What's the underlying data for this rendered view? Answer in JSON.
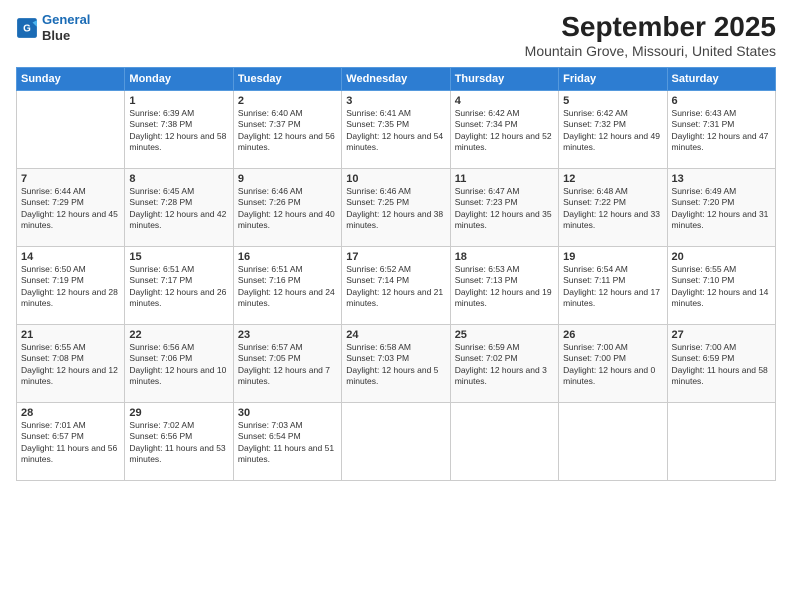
{
  "logo": {
    "line1": "General",
    "line2": "Blue"
  },
  "title": "September 2025",
  "location": "Mountain Grove, Missouri, United States",
  "days_header": [
    "Sunday",
    "Monday",
    "Tuesday",
    "Wednesday",
    "Thursday",
    "Friday",
    "Saturday"
  ],
  "weeks": [
    [
      {
        "day": "",
        "sunrise": "",
        "sunset": "",
        "daylight": ""
      },
      {
        "day": "1",
        "sunrise": "Sunrise: 6:39 AM",
        "sunset": "Sunset: 7:38 PM",
        "daylight": "Daylight: 12 hours and 58 minutes."
      },
      {
        "day": "2",
        "sunrise": "Sunrise: 6:40 AM",
        "sunset": "Sunset: 7:37 PM",
        "daylight": "Daylight: 12 hours and 56 minutes."
      },
      {
        "day": "3",
        "sunrise": "Sunrise: 6:41 AM",
        "sunset": "Sunset: 7:35 PM",
        "daylight": "Daylight: 12 hours and 54 minutes."
      },
      {
        "day": "4",
        "sunrise": "Sunrise: 6:42 AM",
        "sunset": "Sunset: 7:34 PM",
        "daylight": "Daylight: 12 hours and 52 minutes."
      },
      {
        "day": "5",
        "sunrise": "Sunrise: 6:42 AM",
        "sunset": "Sunset: 7:32 PM",
        "daylight": "Daylight: 12 hours and 49 minutes."
      },
      {
        "day": "6",
        "sunrise": "Sunrise: 6:43 AM",
        "sunset": "Sunset: 7:31 PM",
        "daylight": "Daylight: 12 hours and 47 minutes."
      }
    ],
    [
      {
        "day": "7",
        "sunrise": "Sunrise: 6:44 AM",
        "sunset": "Sunset: 7:29 PM",
        "daylight": "Daylight: 12 hours and 45 minutes."
      },
      {
        "day": "8",
        "sunrise": "Sunrise: 6:45 AM",
        "sunset": "Sunset: 7:28 PM",
        "daylight": "Daylight: 12 hours and 42 minutes."
      },
      {
        "day": "9",
        "sunrise": "Sunrise: 6:46 AM",
        "sunset": "Sunset: 7:26 PM",
        "daylight": "Daylight: 12 hours and 40 minutes."
      },
      {
        "day": "10",
        "sunrise": "Sunrise: 6:46 AM",
        "sunset": "Sunset: 7:25 PM",
        "daylight": "Daylight: 12 hours and 38 minutes."
      },
      {
        "day": "11",
        "sunrise": "Sunrise: 6:47 AM",
        "sunset": "Sunset: 7:23 PM",
        "daylight": "Daylight: 12 hours and 35 minutes."
      },
      {
        "day": "12",
        "sunrise": "Sunrise: 6:48 AM",
        "sunset": "Sunset: 7:22 PM",
        "daylight": "Daylight: 12 hours and 33 minutes."
      },
      {
        "day": "13",
        "sunrise": "Sunrise: 6:49 AM",
        "sunset": "Sunset: 7:20 PM",
        "daylight": "Daylight: 12 hours and 31 minutes."
      }
    ],
    [
      {
        "day": "14",
        "sunrise": "Sunrise: 6:50 AM",
        "sunset": "Sunset: 7:19 PM",
        "daylight": "Daylight: 12 hours and 28 minutes."
      },
      {
        "day": "15",
        "sunrise": "Sunrise: 6:51 AM",
        "sunset": "Sunset: 7:17 PM",
        "daylight": "Daylight: 12 hours and 26 minutes."
      },
      {
        "day": "16",
        "sunrise": "Sunrise: 6:51 AM",
        "sunset": "Sunset: 7:16 PM",
        "daylight": "Daylight: 12 hours and 24 minutes."
      },
      {
        "day": "17",
        "sunrise": "Sunrise: 6:52 AM",
        "sunset": "Sunset: 7:14 PM",
        "daylight": "Daylight: 12 hours and 21 minutes."
      },
      {
        "day": "18",
        "sunrise": "Sunrise: 6:53 AM",
        "sunset": "Sunset: 7:13 PM",
        "daylight": "Daylight: 12 hours and 19 minutes."
      },
      {
        "day": "19",
        "sunrise": "Sunrise: 6:54 AM",
        "sunset": "Sunset: 7:11 PM",
        "daylight": "Daylight: 12 hours and 17 minutes."
      },
      {
        "day": "20",
        "sunrise": "Sunrise: 6:55 AM",
        "sunset": "Sunset: 7:10 PM",
        "daylight": "Daylight: 12 hours and 14 minutes."
      }
    ],
    [
      {
        "day": "21",
        "sunrise": "Sunrise: 6:55 AM",
        "sunset": "Sunset: 7:08 PM",
        "daylight": "Daylight: 12 hours and 12 minutes."
      },
      {
        "day": "22",
        "sunrise": "Sunrise: 6:56 AM",
        "sunset": "Sunset: 7:06 PM",
        "daylight": "Daylight: 12 hours and 10 minutes."
      },
      {
        "day": "23",
        "sunrise": "Sunrise: 6:57 AM",
        "sunset": "Sunset: 7:05 PM",
        "daylight": "Daylight: 12 hours and 7 minutes."
      },
      {
        "day": "24",
        "sunrise": "Sunrise: 6:58 AM",
        "sunset": "Sunset: 7:03 PM",
        "daylight": "Daylight: 12 hours and 5 minutes."
      },
      {
        "day": "25",
        "sunrise": "Sunrise: 6:59 AM",
        "sunset": "Sunset: 7:02 PM",
        "daylight": "Daylight: 12 hours and 3 minutes."
      },
      {
        "day": "26",
        "sunrise": "Sunrise: 7:00 AM",
        "sunset": "Sunset: 7:00 PM",
        "daylight": "Daylight: 12 hours and 0 minutes."
      },
      {
        "day": "27",
        "sunrise": "Sunrise: 7:00 AM",
        "sunset": "Sunset: 6:59 PM",
        "daylight": "Daylight: 11 hours and 58 minutes."
      }
    ],
    [
      {
        "day": "28",
        "sunrise": "Sunrise: 7:01 AM",
        "sunset": "Sunset: 6:57 PM",
        "daylight": "Daylight: 11 hours and 56 minutes."
      },
      {
        "day": "29",
        "sunrise": "Sunrise: 7:02 AM",
        "sunset": "Sunset: 6:56 PM",
        "daylight": "Daylight: 11 hours and 53 minutes."
      },
      {
        "day": "30",
        "sunrise": "Sunrise: 7:03 AM",
        "sunset": "Sunset: 6:54 PM",
        "daylight": "Daylight: 11 hours and 51 minutes."
      },
      {
        "day": "",
        "sunrise": "",
        "sunset": "",
        "daylight": ""
      },
      {
        "day": "",
        "sunrise": "",
        "sunset": "",
        "daylight": ""
      },
      {
        "day": "",
        "sunrise": "",
        "sunset": "",
        "daylight": ""
      },
      {
        "day": "",
        "sunrise": "",
        "sunset": "",
        "daylight": ""
      }
    ]
  ]
}
